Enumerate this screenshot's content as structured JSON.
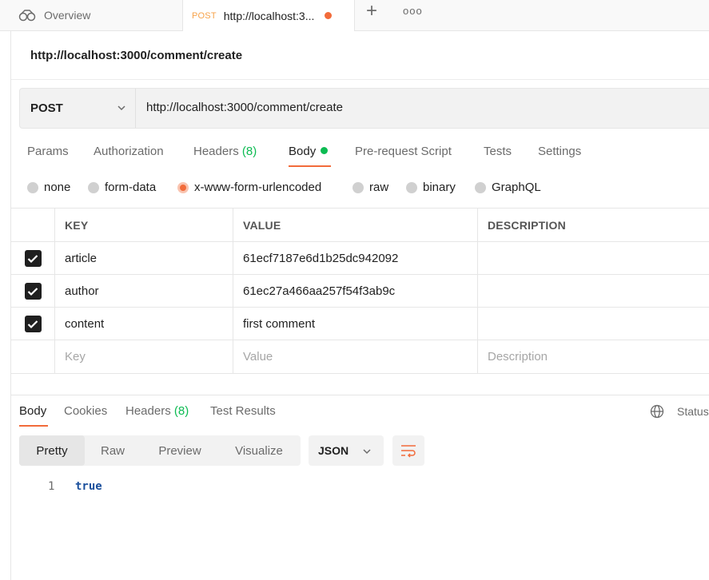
{
  "tabs": {
    "overview_label": "Overview",
    "active_method": "POST",
    "active_label": "http://localhost:3...",
    "new_tab_icon": "+",
    "more_icon": "ooo"
  },
  "request": {
    "title": "http://localhost:3000/comment/create",
    "method": "POST",
    "url": "http://localhost:3000/comment/create"
  },
  "request_tabs": {
    "params": "Params",
    "authorization": "Authorization",
    "headers": "Headers",
    "headers_count": "(8)",
    "body": "Body",
    "prerequest": "Pre-request Script",
    "tests": "Tests",
    "settings": "Settings"
  },
  "body_types": {
    "none": "none",
    "form_data": "form-data",
    "urlencoded": "x-www-form-urlencoded",
    "raw": "raw",
    "binary": "binary",
    "graphql": "GraphQL",
    "selected": "x-www-form-urlencoded"
  },
  "table": {
    "headers": {
      "key": "KEY",
      "value": "VALUE",
      "description": "DESCRIPTION"
    },
    "rows": [
      {
        "key": "article",
        "value": "61ecf7187e6d1b25dc942092",
        "description": "",
        "checked": true
      },
      {
        "key": "author",
        "value": "61ec27a466aa257f54f3ab9c",
        "description": "",
        "checked": true
      },
      {
        "key": "content",
        "value": "first comment",
        "description": "",
        "checked": true
      }
    ],
    "placeholders": {
      "key": "Key",
      "value": "Value",
      "description": "Description"
    }
  },
  "response_tabs": {
    "body": "Body",
    "cookies": "Cookies",
    "headers": "Headers",
    "headers_count": "(8)",
    "test_results": "Test Results",
    "status": "Status"
  },
  "view_modes": {
    "pretty": "Pretty",
    "raw": "Raw",
    "preview": "Preview",
    "visualize": "Visualize",
    "format": "JSON"
  },
  "response": {
    "line_number": "1",
    "content": "true"
  },
  "colors": {
    "accent": "#f26b3a",
    "green": "#0cbb52",
    "code": "#1a4f9c"
  }
}
